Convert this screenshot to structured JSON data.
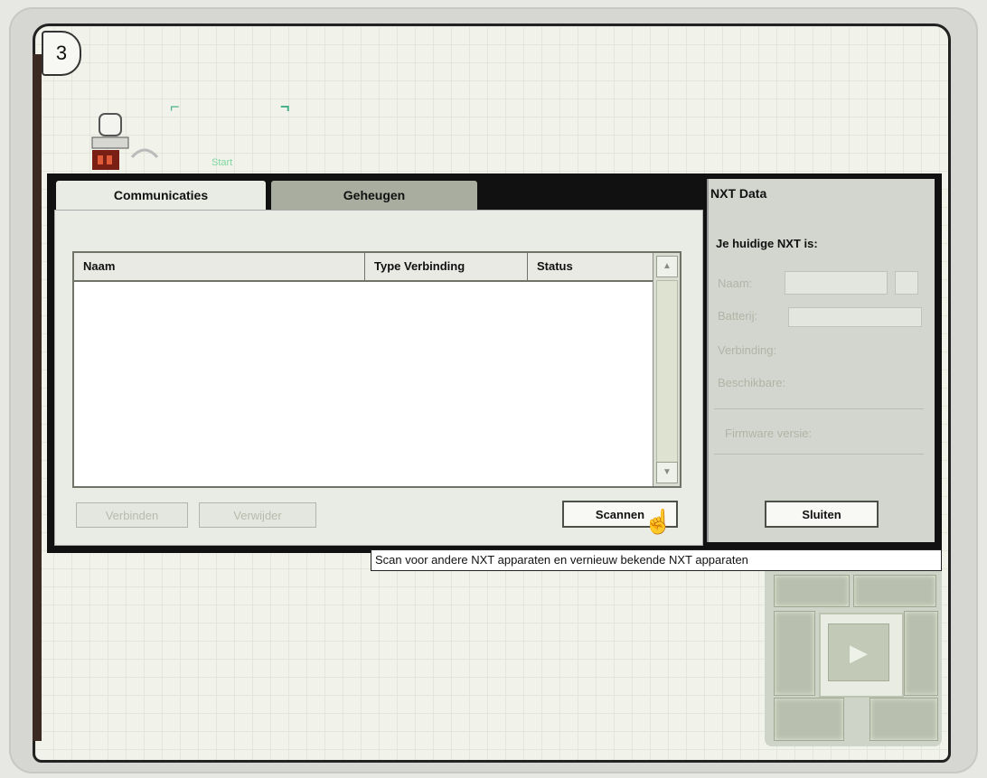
{
  "step": {
    "number": "3"
  },
  "canvas": {
    "start_label": "Start"
  },
  "dialog": {
    "tabs": [
      {
        "label": "Communicaties",
        "active": true
      },
      {
        "label": "Geheugen",
        "active": false
      }
    ],
    "table": {
      "columns": [
        "Naam",
        "Type Verbinding",
        "Status"
      ],
      "rows": []
    },
    "buttons": {
      "connect": "Verbinden",
      "remove": "Verwijder",
      "scan": "Scannen"
    }
  },
  "nxt_panel": {
    "title": "NXT Data",
    "current_label": "Je huidige NXT is:",
    "fields": [
      "Naam:",
      "Batterij:",
      "Verbinding:",
      "Beschikbare:"
    ],
    "firmware_label": "Firmware versie:",
    "close_button": "Sluiten"
  },
  "tooltip": {
    "text": "Scan voor andere NXT apparaten en vernieuw bekende NXT apparaten"
  }
}
